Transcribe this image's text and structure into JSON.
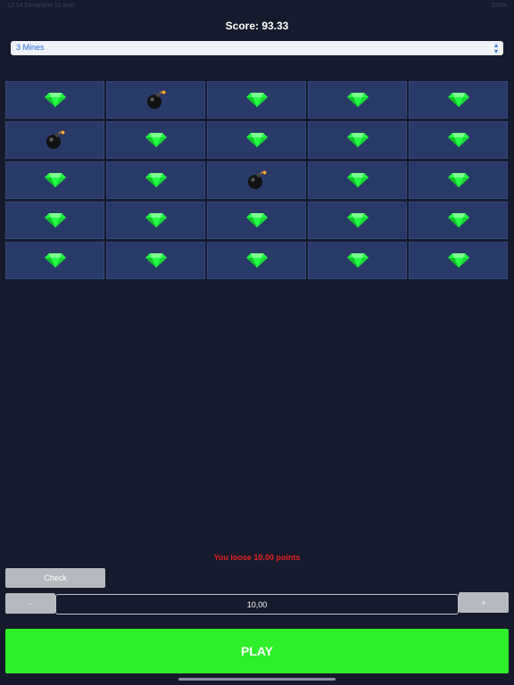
{
  "status_bar": {
    "left": "12:14   Dimanche 11 avril",
    "right": "100%"
  },
  "score_label": "Score: 93.33",
  "mines_select": {
    "value": "3 Mines"
  },
  "grid": [
    [
      "gem",
      "bomb",
      "gem",
      "gem",
      "gem"
    ],
    [
      "bomb",
      "gem",
      "gem",
      "gem",
      "gem"
    ],
    [
      "gem",
      "gem",
      "bomb",
      "gem",
      "gem"
    ],
    [
      "gem",
      "gem",
      "gem",
      "gem",
      "gem"
    ],
    [
      "gem",
      "gem",
      "gem",
      "gem",
      "gem"
    ]
  ],
  "result_message": "You loose 10.00 points",
  "check_label": "Check",
  "minus_label": "-",
  "plus_label": "+",
  "bet_value": "10,00",
  "play_label": "PLAY",
  "colors": {
    "gem": "#22ff44",
    "bomb": "#111111",
    "play": "#2ef02a",
    "loss": "#e52020",
    "tile": "#2a3a68"
  }
}
